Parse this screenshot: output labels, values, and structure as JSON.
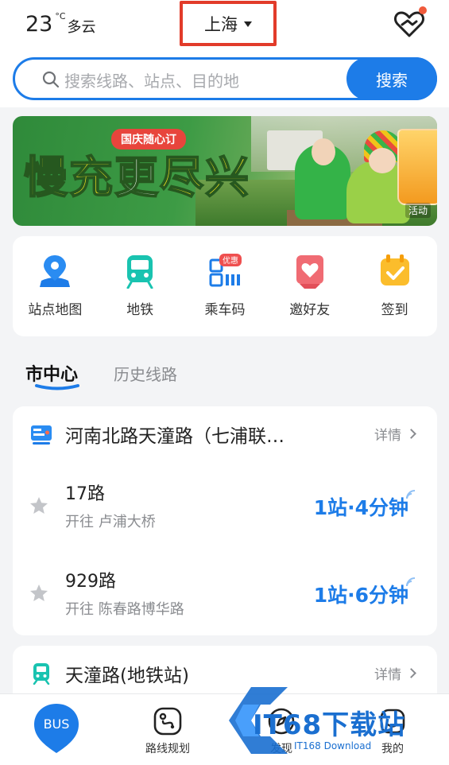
{
  "weather": {
    "temp": "23",
    "unit": "°C",
    "condition": "多云"
  },
  "city": "上海",
  "search": {
    "placeholder": "搜索线路、站点、目的地",
    "button": "搜索"
  },
  "banner": {
    "tag": "国庆随心订",
    "title_a": "慢充",
    "title_b": "更",
    "title_c": "尽兴",
    "badge": "活动"
  },
  "quick": [
    {
      "label": "站点地图",
      "icon": "map-pin-icon"
    },
    {
      "label": "地铁",
      "icon": "metro-icon"
    },
    {
      "label": "乘车码",
      "icon": "qr-code-icon",
      "badge": "优惠"
    },
    {
      "label": "邀好友",
      "icon": "invite-heart-icon"
    },
    {
      "label": "签到",
      "icon": "checkin-calendar-icon"
    }
  ],
  "tabs": {
    "active": "市中心",
    "other": "历史线路"
  },
  "stops": [
    {
      "name": "河南北路天潼路（七浦联…",
      "detail": "详情",
      "routes": [
        {
          "no": "17路",
          "direction": "开往 卢浦大桥",
          "eta": "1站·4分钟"
        },
        {
          "no": "929路",
          "direction": "开往 陈春路博华路",
          "eta": "1站·6分钟"
        }
      ]
    },
    {
      "name": "天潼路(地铁站)",
      "detail": "详情"
    }
  ],
  "nav": {
    "bus": "BUS",
    "plan": "路线规划",
    "discover": "发现",
    "mine": "我的"
  },
  "watermark": {
    "main": "IT68下载站",
    "sub": "IT168 Download"
  },
  "colors": {
    "accent": "#1d7ce8",
    "highlight": "#e23b2a"
  }
}
